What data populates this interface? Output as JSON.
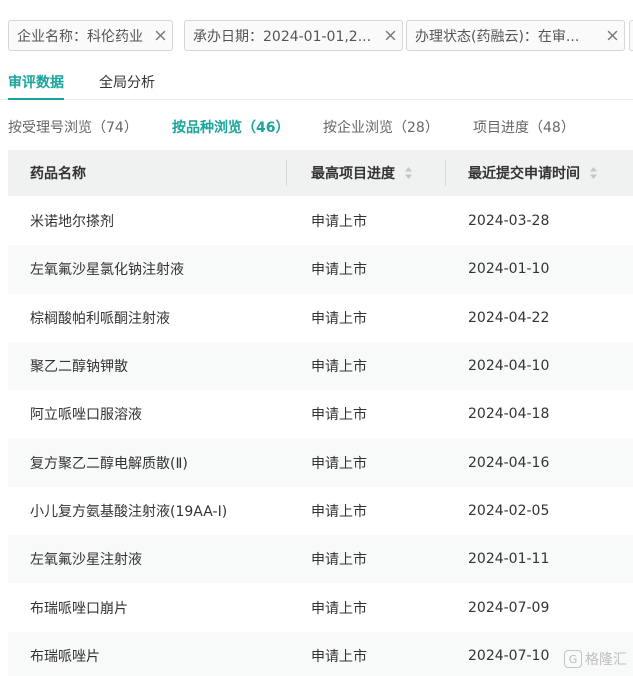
{
  "filters": [
    {
      "label": "企业名称：科伦药业"
    },
    {
      "label": "承办日期：2024-01-01,2..."
    },
    {
      "label": "办理状态(药融云)：在审..."
    }
  ],
  "main_tabs": [
    {
      "label": "审评数据",
      "active": true
    },
    {
      "label": "全局分析",
      "active": false
    }
  ],
  "sub_tabs": [
    {
      "label": "按受理号浏览（74）",
      "active": false
    },
    {
      "label": "按品种浏览（46）",
      "active": true
    },
    {
      "label": "按企业浏览（28）",
      "active": false
    },
    {
      "label": "项目进度（48）",
      "active": false
    }
  ],
  "table": {
    "columns": [
      "药品名称",
      "最高项目进度",
      "最近提交申请时间"
    ],
    "rows": [
      {
        "name": "米诺地尔搽剂",
        "stage": "申请上市",
        "date": "2024-03-28"
      },
      {
        "name": "左氧氟沙星氯化钠注射液",
        "stage": "申请上市",
        "date": "2024-01-10"
      },
      {
        "name": "棕榈酸帕利哌酮注射液",
        "stage": "申请上市",
        "date": "2024-04-22"
      },
      {
        "name": "聚乙二醇钠钾散",
        "stage": "申请上市",
        "date": "2024-04-10"
      },
      {
        "name": "阿立哌唑口服溶液",
        "stage": "申请上市",
        "date": "2024-04-18"
      },
      {
        "name": "复方聚乙二醇电解质散(Ⅱ)",
        "stage": "申请上市",
        "date": "2024-04-16"
      },
      {
        "name": "小儿复方氨基酸注射液(19AA-Ⅰ)",
        "stage": "申请上市",
        "date": "2024-02-05"
      },
      {
        "name": "左氧氟沙星注射液",
        "stage": "申请上市",
        "date": "2024-01-11"
      },
      {
        "name": "布瑞哌唑口崩片",
        "stage": "申请上市",
        "date": "2024-07-09"
      },
      {
        "name": "布瑞哌唑片",
        "stage": "申请上市",
        "date": "2024-07-10"
      }
    ]
  },
  "watermark": {
    "text": "格隆汇"
  },
  "colors": {
    "accent": "#1aa59a",
    "header_bg": "#f0f2f1",
    "stripe": "#f8f9f9"
  },
  "icons": {
    "chip_close": "close-icon",
    "sort": "sort-icon"
  }
}
